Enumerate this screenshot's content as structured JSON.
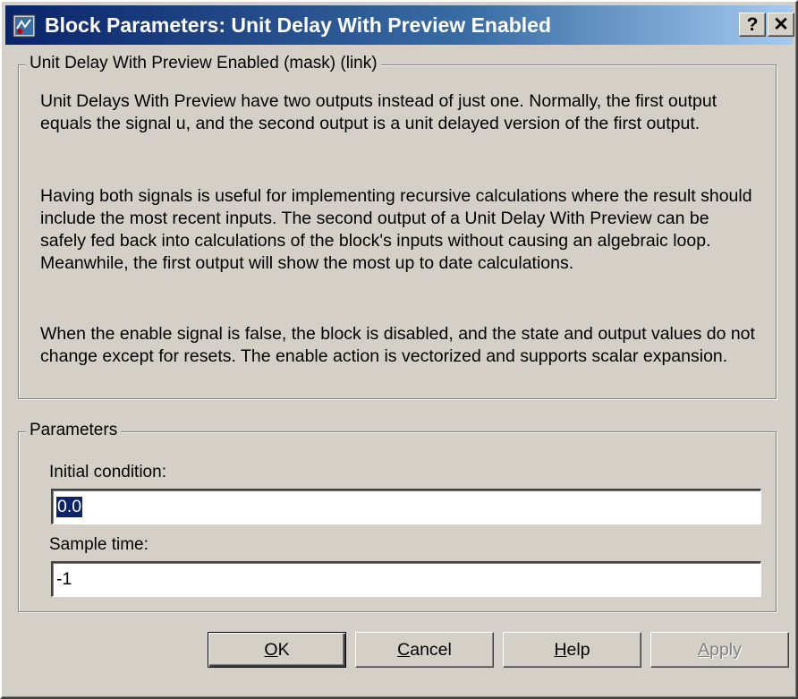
{
  "window": {
    "title": "Block Parameters: Unit Delay With Preview Enabled",
    "help_glyph": "?",
    "close_glyph": "✕",
    "icon": "simulink-block-icon"
  },
  "description": {
    "legend": "Unit Delay With Preview Enabled (mask) (link)",
    "paragraph1": "Unit Delays With Preview have two outputs instead of just one.  Normally, the first output equals the signal u, and the second output is a unit delayed version of the first output.",
    "paragraph2": "Having both signals is useful for implementing recursive calculations where the result should include the most recent inputs.  The second output of a Unit Delay With Preview can be safely fed back into calculations of the block's inputs without causing an algebraic loop.  Meanwhile, the first output will show the most up to date calculations.",
    "paragraph3": "When the enable signal is false, the block is disabled, and the state and output values do not change except for resets.  The enable action is vectorized and supports scalar expansion."
  },
  "parameters": {
    "legend": "Parameters",
    "initial_condition_label": "Initial condition:",
    "initial_condition_value": "0.0",
    "sample_time_label": "Sample time:",
    "sample_time_value": "-1"
  },
  "buttons": {
    "ok_mnemonic": "O",
    "ok_rest": "K",
    "cancel_mnemonic": "C",
    "cancel_rest": "ancel",
    "help_mnemonic": "H",
    "help_rest": "elp",
    "apply_mnemonic": "A",
    "apply_rest": "pply"
  },
  "colors": {
    "titlebar_start": "#0a246a",
    "titlebar_end": "#a6caf0",
    "face": "#d4d0c8",
    "selection": "#0a246a"
  }
}
